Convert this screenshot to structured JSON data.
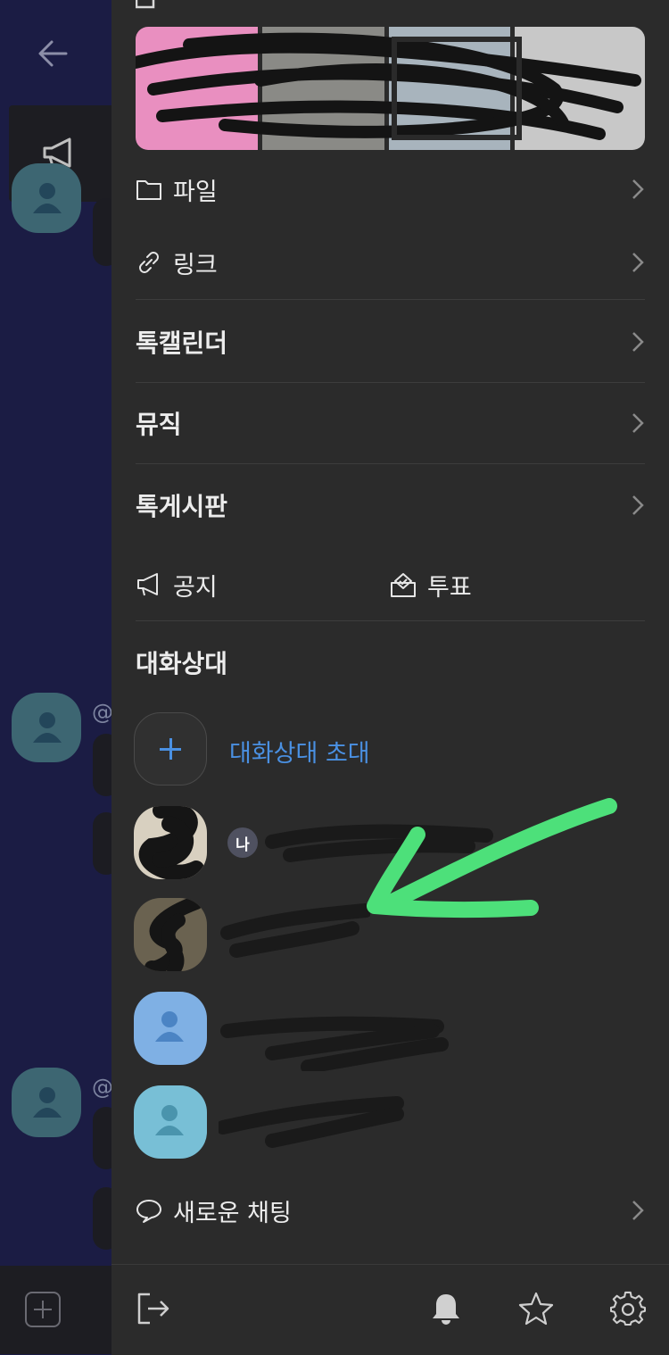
{
  "background_chat": {
    "at_symbol_1": "@",
    "at_symbol_2": "@"
  },
  "drawer": {
    "menu": {
      "files_label": "파일",
      "links_label": "링크",
      "calendar_label": "톡캘린더",
      "music_label": "뮤직",
      "board_label": "톡게시판",
      "notice_label": "공지",
      "poll_label": "투표"
    },
    "members": {
      "section_title": "대화상대",
      "invite_label": "대화상대 초대",
      "me_badge": "나"
    },
    "new_chat_label": "새로운 채팅"
  },
  "colors": {
    "accent": "#4a90e2",
    "drawer_bg": "#2b2b2b",
    "chat_bg": "#1b1c44",
    "annotation_arrow": "#4de07a",
    "avatar_blue": "#7fb0e4",
    "avatar_teal": "#78bfd6"
  },
  "icons": [
    "back-arrow-icon",
    "megaphone-icon",
    "folder-icon",
    "link-icon",
    "chevron-right-icon",
    "ballot-icon",
    "plus-icon",
    "person-icon",
    "speech-bubble-icon",
    "exit-icon",
    "bell-icon",
    "star-icon",
    "gear-icon"
  ]
}
